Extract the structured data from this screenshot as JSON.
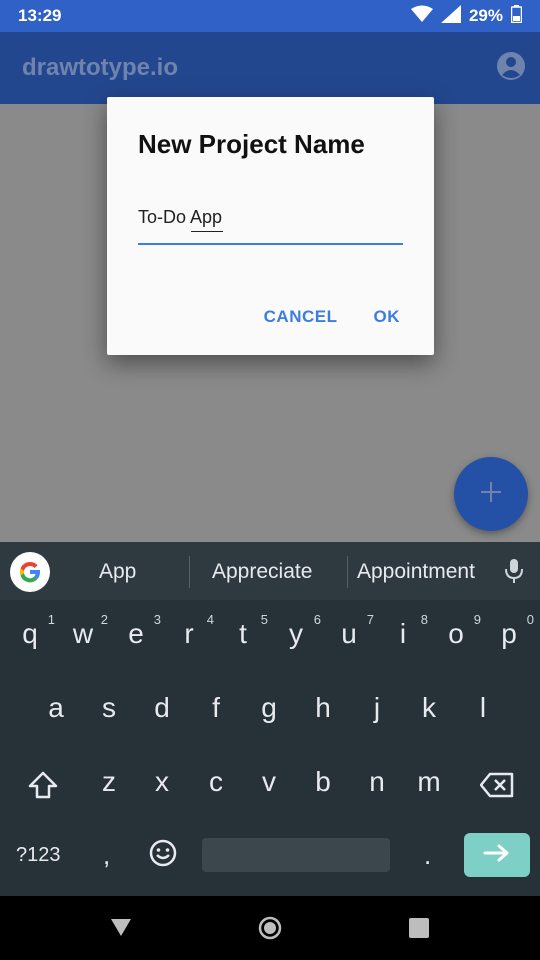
{
  "status_bar": {
    "time": "13:29",
    "battery": "29%"
  },
  "app_bar": {
    "title": "drawtotype.io"
  },
  "dialog": {
    "title": "New Project Name",
    "input_value": "To-Do App",
    "cancel_label": "CANCEL",
    "ok_label": "OK"
  },
  "keyboard": {
    "suggestions": [
      "App",
      "Appreciate",
      "Appointment"
    ],
    "row1": [
      {
        "k": "q",
        "h": "1"
      },
      {
        "k": "w",
        "h": "2"
      },
      {
        "k": "e",
        "h": "3"
      },
      {
        "k": "r",
        "h": "4"
      },
      {
        "k": "t",
        "h": "5"
      },
      {
        "k": "y",
        "h": "6"
      },
      {
        "k": "u",
        "h": "7"
      },
      {
        "k": "i",
        "h": "8"
      },
      {
        "k": "o",
        "h": "9"
      },
      {
        "k": "p",
        "h": "0"
      }
    ],
    "row2": [
      "a",
      "s",
      "d",
      "f",
      "g",
      "h",
      "j",
      "k",
      "l"
    ],
    "row3": [
      "z",
      "x",
      "c",
      "v",
      "b",
      "n",
      "m"
    ],
    "symbols_label": "?123",
    "comma": ",",
    "period": "."
  },
  "colors": {
    "status_bar": "#2f61c7",
    "app_bar": "#23478f",
    "accent": "#3b7de0",
    "fab": "#2450a6",
    "keyboard_bg": "#263238",
    "enter_key": "#7ecfc6"
  },
  "icons": [
    "wifi-icon",
    "signal-icon",
    "battery-icon",
    "account-icon",
    "add-icon",
    "google-icon",
    "mic-icon",
    "shift-icon",
    "backspace-icon",
    "emoji-icon",
    "enter-arrow-icon",
    "nav-back-icon",
    "nav-home-icon",
    "nav-recents-icon"
  ]
}
